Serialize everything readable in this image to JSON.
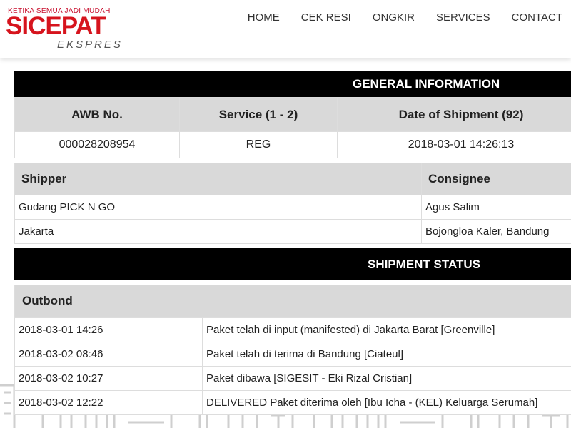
{
  "header": {
    "tagline": "KETIKA SEMUA JADI MUDAH",
    "brand": "SICEPAT",
    "brand_sub": "EKSPRES",
    "nav": [
      "HOME",
      "CEK RESI",
      "ONGKIR",
      "SERVICES",
      "CONTACT"
    ]
  },
  "general": {
    "title": "GENERAL INFORMATION",
    "headers": [
      "AWB No.",
      "Service (1 - 2)",
      "Date of Shipment (92)"
    ],
    "values": [
      "000028208954",
      "REG",
      "2018-03-01 14:26:13"
    ]
  },
  "parties": {
    "shipper_label": "Shipper",
    "consignee_label": "Consignee",
    "shipper_name": "Gudang PICK N GO",
    "shipper_city": "Jakarta",
    "consignee_name": "Agus Salim",
    "consignee_city": "Bojongloa Kaler, Bandung"
  },
  "status": {
    "title": "SHIPMENT STATUS",
    "section": "Outbond",
    "rows": [
      {
        "time": "2018-03-01 14:26",
        "desc": "Paket telah di input (manifested) di Jakarta Barat [Greenville]"
      },
      {
        "time": "2018-03-02 08:46",
        "desc": "Paket telah di terima di Bandung [Ciateul]"
      },
      {
        "time": "2018-03-02 10:27",
        "desc": "Paket dibawa [SIGESIT - Eki Rizal Cristian]"
      },
      {
        "time": "2018-03-02 12:22",
        "desc": "DELIVERED Paket diterima oleh [Ibu Icha - (KEL) Keluarga Serumah]"
      }
    ]
  },
  "colors": {
    "brand_red": "#d6141d",
    "bar_black": "#000000",
    "header_gray": "#d9d9d9"
  }
}
